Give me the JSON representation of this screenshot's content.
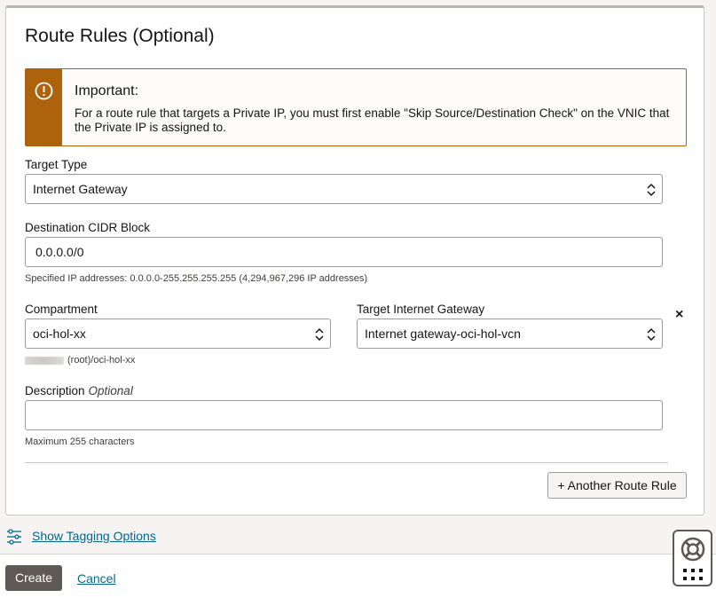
{
  "panel": {
    "title": "Route Rules (Optional)"
  },
  "alert": {
    "icon": "exclamation-circle-icon",
    "title": "Important:",
    "body": "For a route rule that targets a Private IP, you must first enable \"Skip Source/Destination Check\" on the VNIC that the Private IP is assigned to.",
    "accent_color": "#ac630c"
  },
  "target_type": {
    "label": "Target Type",
    "value": "Internet Gateway"
  },
  "destination": {
    "label": "Destination CIDR Block",
    "value": "0.0.0.0/0",
    "help": "Specified IP addresses: 0.0.0.0-255.255.255.255 (4,294,967,296 IP addresses)"
  },
  "compartment": {
    "label": "Compartment",
    "value": "oci-hol-xx",
    "path": "(root)/oci-hol-xx"
  },
  "target_gateway": {
    "label": "Target Internet Gateway",
    "value": "Internet gateway-oci-hol-vcn"
  },
  "remove_rule": {
    "icon": "close-icon",
    "label": "×"
  },
  "description": {
    "label": "Description",
    "optional": "Optional",
    "value": "",
    "help": "Maximum 255 characters"
  },
  "another_rule_button": "+ Another Route Rule",
  "tagging": {
    "icon": "sliders-icon",
    "label": "Show Tagging Options"
  },
  "footer": {
    "create": "Create",
    "cancel": "Cancel"
  },
  "help_widget": {
    "icon": "lifebuoy-icon",
    "menu_icon": "grid-dots-icon"
  },
  "colors": {
    "link": "#00688c",
    "primary_button": "#5e5954"
  }
}
